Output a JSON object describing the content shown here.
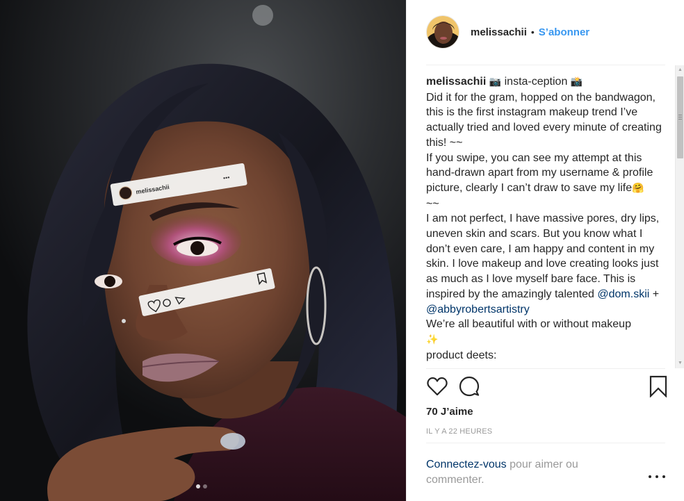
{
  "post": {
    "username": "melissachii",
    "follow_label": "S’abonner",
    "separator": "•"
  },
  "overlay": {
    "username": "melissachii",
    "dots": "•••"
  },
  "caption": {
    "author": "melissachii",
    "title_emoji_1": "📷",
    "title_text": " insta-ception ",
    "title_emoji_2": "📸",
    "body_1": "\nDid it for the gram, hopped on the bandwagon, this is the first instagram makeup trend I’ve actually tried and loved every minute of creating this! ~~\nIf you swipe, you can see my attempt at this hand-drawn apart from my username & profile picture, clearly I can’t draw to save my life",
    "emoji_hug": "🤗",
    "body_2": "\n~~\nI am not perfect, I have massive pores, dry lips, uneven skin and scars. But you know what I don’t even care, I am happy and content in my skin. I love makeup and love creating looks just as much as I love myself bare face. This is inspired by the amazingly talented ",
    "mention_1": "@dom.skii",
    "plus": " + ",
    "mention_2": "@abbyrobertsartistry",
    "body_3": "\nWe’re all beautiful with or without makeup\n",
    "emoji_sparkles": "✨",
    "body_4": "\nproduct deets:"
  },
  "icons": {
    "like": "heart-icon",
    "comment": "comment-icon",
    "save": "bookmark-icon",
    "more": "more-horizontal-icon",
    "title_emoji": "camera-icon"
  },
  "likes_label": "70 J’aime",
  "timestamp": "IL Y A 22 HEURES",
  "login": {
    "link_label": "Connectez-vous",
    "rest_label": " pour aimer ou commenter."
  },
  "colors": {
    "accent": "#3897f0",
    "mention": "#003569",
    "muted": "#999999",
    "text": "#262626"
  }
}
